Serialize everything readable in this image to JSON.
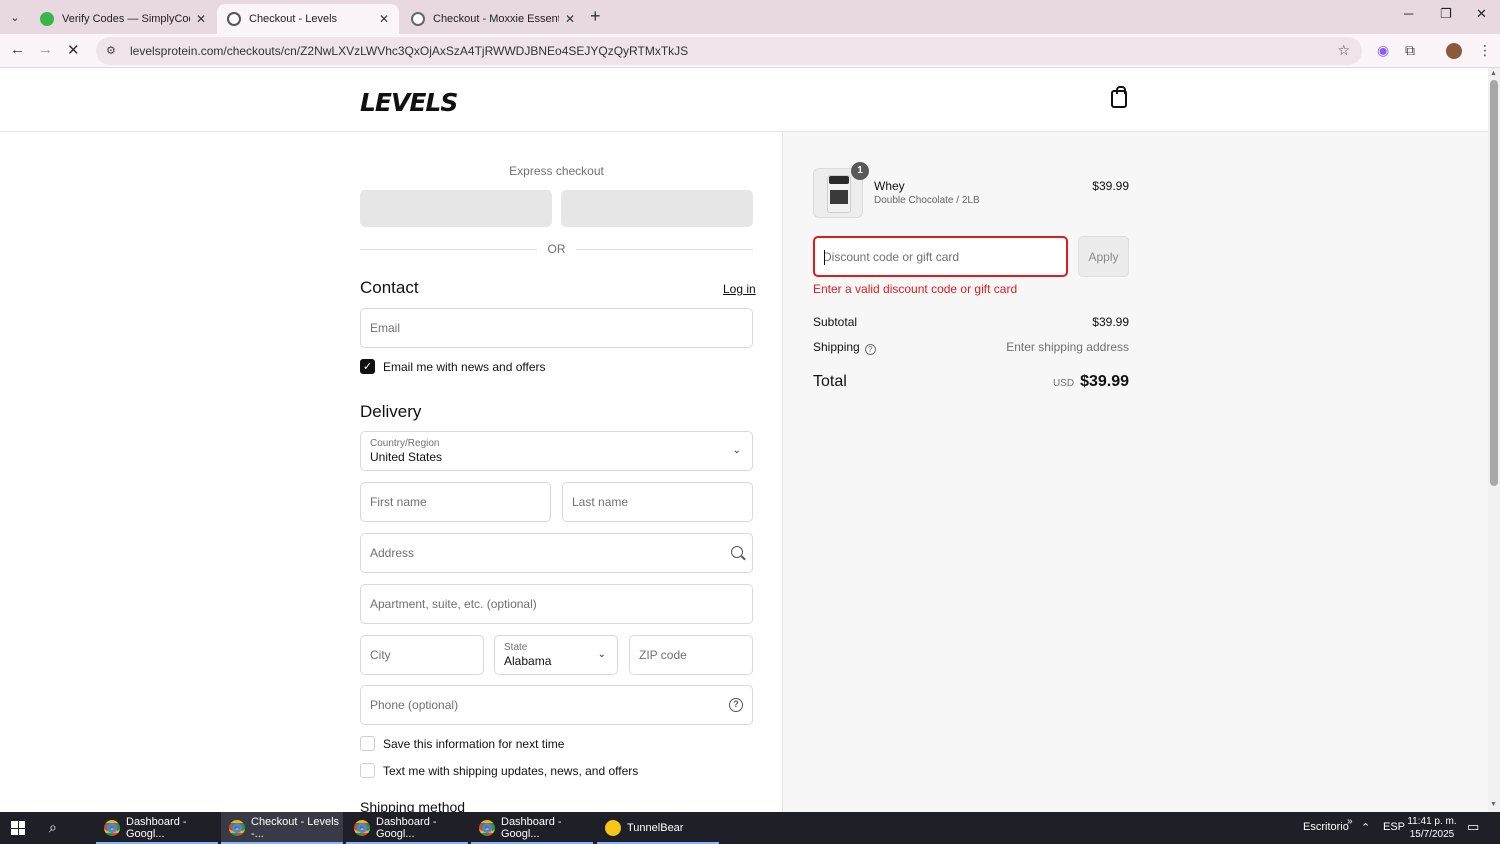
{
  "browser": {
    "tabs": [
      {
        "title": "Verify Codes — SimplyCodes",
        "favicon_color": "#3ab54a"
      },
      {
        "title": "Checkout - Levels",
        "favicon_color": "#555555"
      },
      {
        "title": "Checkout - Moxxie Essential Ca",
        "favicon_color": "#666666"
      }
    ],
    "url": "levelsprotein.com/checkouts/cn/Z2NwLXVzLWVhc3QxOjAxSzA4TjRWWDJBNEo4SEJYQzQyRTMxTkJS"
  },
  "store": {
    "logo_text": "LEVELS"
  },
  "checkout": {
    "express_label": "Express checkout",
    "or_label": "OR",
    "contact": {
      "heading": "Contact",
      "login_label": "Log in",
      "email_placeholder": "Email",
      "news_checkbox_label": "Email me with news and offers",
      "news_checked": true
    },
    "delivery": {
      "heading": "Delivery",
      "country_label": "Country/Region",
      "country_value": "United States",
      "first_name_placeholder": "First name",
      "last_name_placeholder": "Last name",
      "address_placeholder": "Address",
      "apartment_placeholder": "Apartment, suite, etc. (optional)",
      "city_placeholder": "City",
      "state_label": "State",
      "state_value": "Alabama",
      "zip_placeholder": "ZIP code",
      "phone_placeholder": "Phone (optional)",
      "save_info_label": "Save this information for next time",
      "text_me_label": "Text me with shipping updates, news, and offers"
    },
    "shipping_method_heading": "Shipping method"
  },
  "summary": {
    "item": {
      "quantity": "1",
      "name": "Whey",
      "variant": "Double Chocolate / 2LB",
      "price": "$39.99"
    },
    "discount_placeholder": "Discount code or gift card",
    "apply_label": "Apply",
    "error_text": "Enter a valid discount code or gift card",
    "subtotal_label": "Subtotal",
    "subtotal_value": "$39.99",
    "shipping_label": "Shipping",
    "shipping_value": "Enter shipping address",
    "total_label": "Total",
    "total_currency": "USD",
    "total_value": "$39.99"
  },
  "taskbar": {
    "items": [
      {
        "label": "Dashboard - Googl...",
        "icon": "chrome-icon"
      },
      {
        "label": "Checkout - Levels -...",
        "icon": "chrome-icon"
      },
      {
        "label": "Dashboard - Googl...",
        "icon": "chrome-icon"
      },
      {
        "label": "Dashboard - Googl...",
        "icon": "chrome-icon"
      },
      {
        "label": "TunnelBear",
        "icon": "tunnelbear-icon"
      }
    ],
    "desktop_label": "Escritorio",
    "language": "ESP",
    "time": "11:41 p. m.",
    "date": "15/7/2025"
  }
}
